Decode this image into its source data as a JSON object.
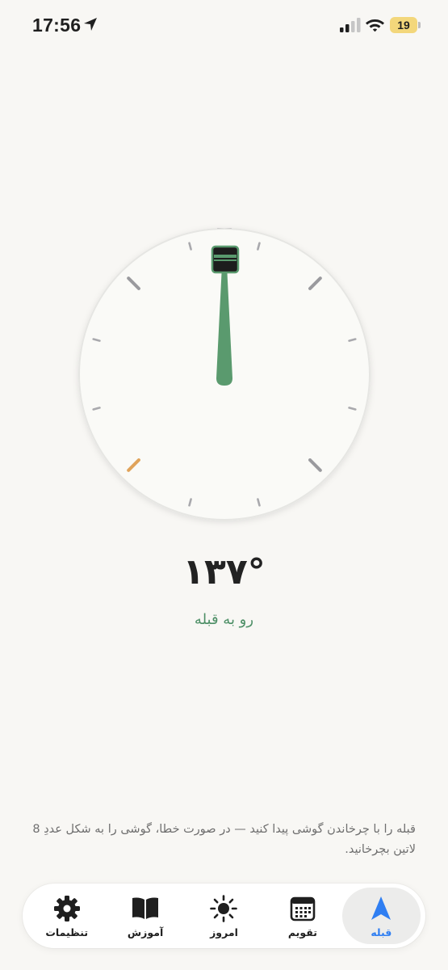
{
  "status_bar": {
    "time": "17:56",
    "battery": "19",
    "icons": [
      "location-arrow-icon",
      "cellular-signal-icon",
      "wifi-icon",
      "battery-icon"
    ]
  },
  "compass": {
    "heading_text": "۱۳۷°",
    "qibla_status": "رو به قبله",
    "colors": {
      "needle": "#5a9a6e",
      "kaaba_border": "#5a9a6e",
      "tick_major": "#9a9a9e",
      "tick_minor": "#a9a9ad",
      "tick_highlight": "#e0a35a",
      "face": "#fafaf7"
    }
  },
  "hint": "قبله را با چرخاندن گوشی پیدا کنید — در صورت خطا، گوشی را به شکل عددِ 8 لاتین بچرخانید.",
  "tabs": [
    {
      "label": "قبله",
      "icon": "qibla-arrow-icon",
      "active": true
    },
    {
      "label": "تقویم",
      "icon": "calendar-icon",
      "active": false
    },
    {
      "label": "امروز",
      "icon": "sun-icon",
      "active": false
    },
    {
      "label": "آموزش",
      "icon": "book-icon",
      "active": false
    },
    {
      "label": "تنظیمات",
      "icon": "gear-icon",
      "active": false
    }
  ],
  "accent_color": "#2f7ef2"
}
